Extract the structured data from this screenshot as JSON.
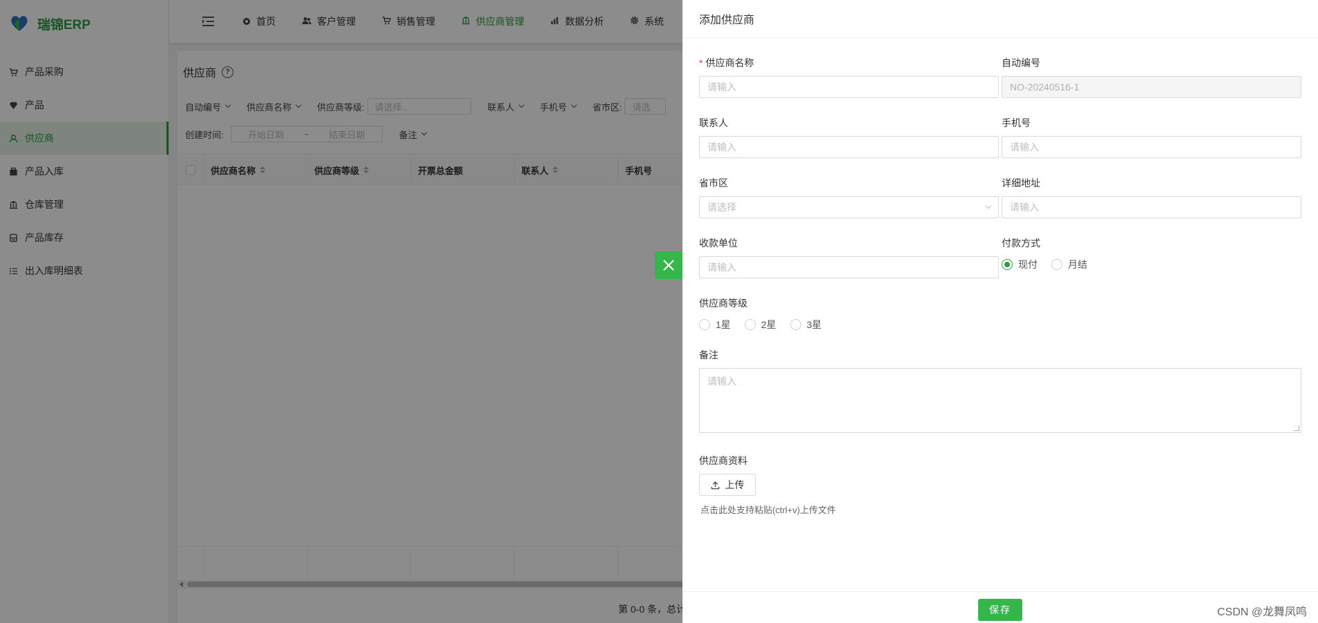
{
  "app": {
    "logo_text": "瑞锦ERP"
  },
  "sidebar": {
    "items": [
      {
        "label": "产品采购",
        "icon": "cart-icon",
        "active": false
      },
      {
        "label": "产品",
        "icon": "gem-icon",
        "active": false
      },
      {
        "label": "供应商",
        "icon": "user-icon",
        "active": true
      },
      {
        "label": "产品入库",
        "icon": "box-icon",
        "active": false
      },
      {
        "label": "仓库管理",
        "icon": "bank-icon",
        "active": false
      },
      {
        "label": "产品库存",
        "icon": "database-icon",
        "active": false
      },
      {
        "label": "出入库明细表",
        "icon": "list-icon",
        "active": false
      }
    ]
  },
  "topnav": {
    "items": [
      {
        "label": "首页",
        "icon": "dashboard-icon"
      },
      {
        "label": "客户管理",
        "icon": "team-icon"
      },
      {
        "label": "销售管理",
        "icon": "cart-icon"
      },
      {
        "label": "供应商管理",
        "icon": "bank-icon",
        "active": true
      },
      {
        "label": "数据分析",
        "icon": "chart-icon"
      },
      {
        "label": "系统",
        "icon": "gear-icon"
      }
    ]
  },
  "page": {
    "title": "供应商",
    "filters_row1": {
      "auto_no": "自动编号",
      "supplier_name": "供应商名称",
      "supplier_level_label": "供应商等级:",
      "supplier_level_placeholder": "请选择...",
      "contact": "联系人",
      "phone": "手机号",
      "region_label": "省市区:",
      "region_placeholder": "请选"
    },
    "filters_row2": {
      "created_label": "创建时间:",
      "start_placeholder": "开始日期",
      "sep": "~",
      "end_placeholder": "结束日期",
      "remark": "备注"
    },
    "table": {
      "columns": [
        "供应商名称",
        "供应商等级",
        "开票总金额",
        "联系人",
        "手机号"
      ]
    },
    "pager_text": "第 0-0 条，总计"
  },
  "drawer": {
    "title": "添加供应商",
    "fields": {
      "supplier_name": {
        "label": "供应商名称",
        "placeholder": "请输入",
        "required": true
      },
      "auto_no": {
        "label": "自动编号",
        "value": "NO-20240516-1"
      },
      "contact": {
        "label": "联系人",
        "placeholder": "请输入"
      },
      "phone": {
        "label": "手机号",
        "placeholder": "请输入"
      },
      "region": {
        "label": "省市区",
        "placeholder": "请选择"
      },
      "address": {
        "label": "详细地址",
        "placeholder": "请输入"
      },
      "payee": {
        "label": "收款单位",
        "placeholder": "请输入"
      },
      "payment": {
        "label": "付款方式",
        "options": [
          "现付",
          "月结"
        ],
        "selected": "现付"
      },
      "level": {
        "label": "供应商等级",
        "options": [
          "1星",
          "2星",
          "3星"
        ]
      },
      "remark": {
        "label": "备注",
        "placeholder": "请输入"
      },
      "materials": {
        "label": "供应商资料",
        "upload_label": "上传",
        "hint": "点击此处支持粘贴(ctrl+v)上传文件"
      }
    },
    "save_label": "保存"
  },
  "watermark": "CSDN @龙舞凤鸣",
  "colors": {
    "primary": "#35b64a",
    "active_bg": "#e3f3e5",
    "required": "#e53935"
  }
}
